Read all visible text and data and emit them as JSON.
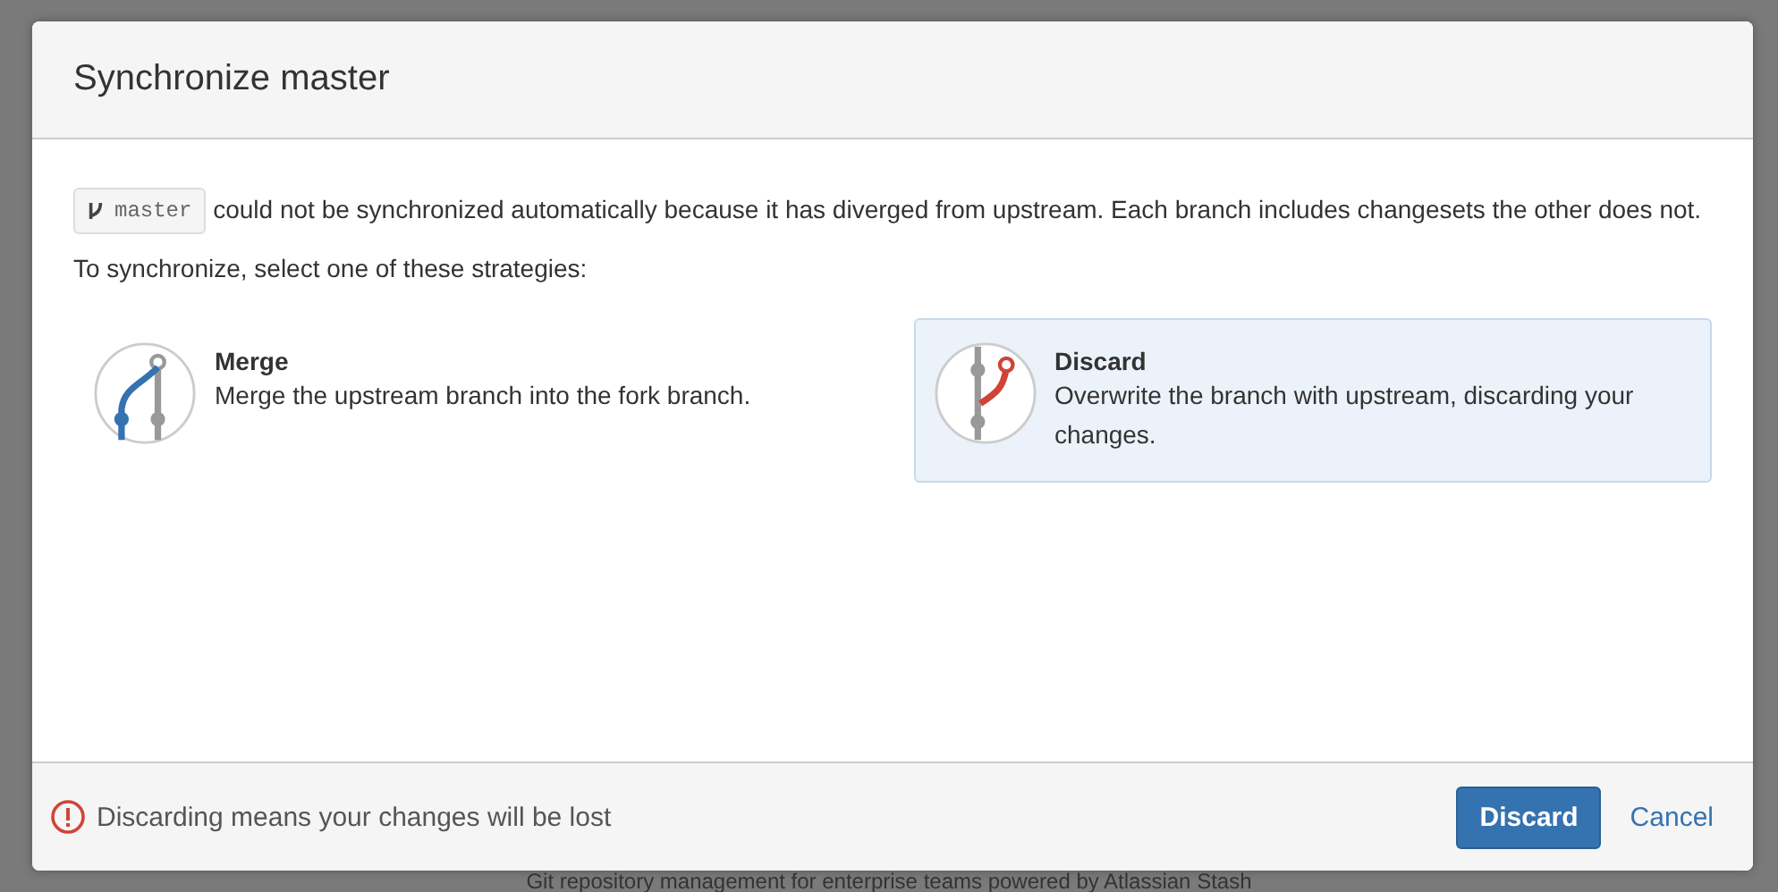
{
  "dialog": {
    "title": "Synchronize master",
    "branch": "master",
    "message": "could not be synchronized automatically because it has diverged from upstream. Each branch includes changesets the other does not.",
    "prompt": "To synchronize, select one of these strategies:",
    "strategies": [
      {
        "kind": "merge",
        "title": "Merge",
        "description": "Merge the upstream branch into the fork branch.",
        "selected": false
      },
      {
        "kind": "discard",
        "title": "Discard",
        "description": "Overwrite the branch with upstream, discarding your changes.",
        "selected": true
      }
    ],
    "warning": "Discarding means your changes will be lost",
    "buttons": [
      {
        "label": "Discard",
        "kind": "primary"
      },
      {
        "label": "Cancel",
        "kind": "link"
      }
    ]
  },
  "background_footer": "Git repository management for enterprise teams powered by Atlassian Stash"
}
